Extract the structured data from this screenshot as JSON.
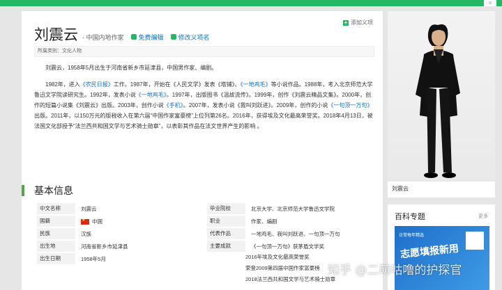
{
  "header": {
    "close_label": "×"
  },
  "entry": {
    "title": "刘震云",
    "subtitle": "- 中国内地作家",
    "edit_label": "免费编辑",
    "modify_label": "修改义项名",
    "add_tag_label": "添加义项",
    "category_label": "所属类别：文化人物"
  },
  "intro": {
    "p1": "刘震云，1958年5月出生于河南省新乡市延津县，中国男作家、编剧。",
    "p2_a": "1982年，进入",
    "p2_b": "《农民日报》",
    "p2_c": "工作。1987年，开始在《人民文学》发表《塔铺》、",
    "p2_d": "《一地鸡毛》",
    "p2_e": "等小说作品。1988年，考入北京师范大学鲁迅文学院读研究生。1992年，发表小说",
    "p2_f": "《一地鸡毛》",
    "p2_g": "。1997年，出版图书《温故流传》。1999年，创作《刘震云精品文集》。2000年，创作的短篇小说集《刘震云》出版。2003年，创作小说",
    "p2_h": "《手机》",
    "p2_i": "。2007年，发表小说《我叫刘跃进》。2009年，创作的小说",
    "p2_j": "《一句顶一万句》",
    "p2_k": "出版。2011年，以150万元的版税收入在第六届“中国作家富豪榜”上位列第26名。2016年，获得埃及文化最高荣誉奖。2018年4月13日，被法国文化部授予“法兰西共和国文学与艺术骑士勋章”，以表彰其作品在法文世界产生的影响 。"
  },
  "basic_info": {
    "heading": "基本信息",
    "rows": [
      {
        "l1": "中文名称",
        "v1": "刘震云",
        "l2": "毕业院校",
        "v2": "北京大学、北京师范大学鲁迅文学院"
      },
      {
        "l1": "国籍",
        "v1": "中国",
        "l2": "职业",
        "v2": "作家、编剧"
      },
      {
        "l1": "民族",
        "v1": "汉族",
        "l2": "代表作品",
        "v2": "一地鸡毛、我叫刘跃进、一句顶一万句"
      },
      {
        "l1": "出生地",
        "v1": "河南省新乡市延津县",
        "l2": "主要成就",
        "v2": "《一句顶一万句》获茅盾文学奖"
      },
      {
        "l1": "出生日期",
        "v1": "1958年5月",
        "l2": "",
        "v2": ""
      }
    ],
    "achievements_extra": [
      "2016年埃及文化最高荣誉奖",
      "荣登2009第四届中国作家富豪榜",
      "2018法兰西共和国文学与艺术骑士勋章"
    ]
  },
  "sidebar": {
    "photo_caption": "刘震云",
    "section_title": "百科专题",
    "more_label": "更多",
    "promo_small": "日常每年精选",
    "promo_big": "志愿填报新用"
  },
  "watermark": "知乎 @二萌咕噜的护探官"
}
